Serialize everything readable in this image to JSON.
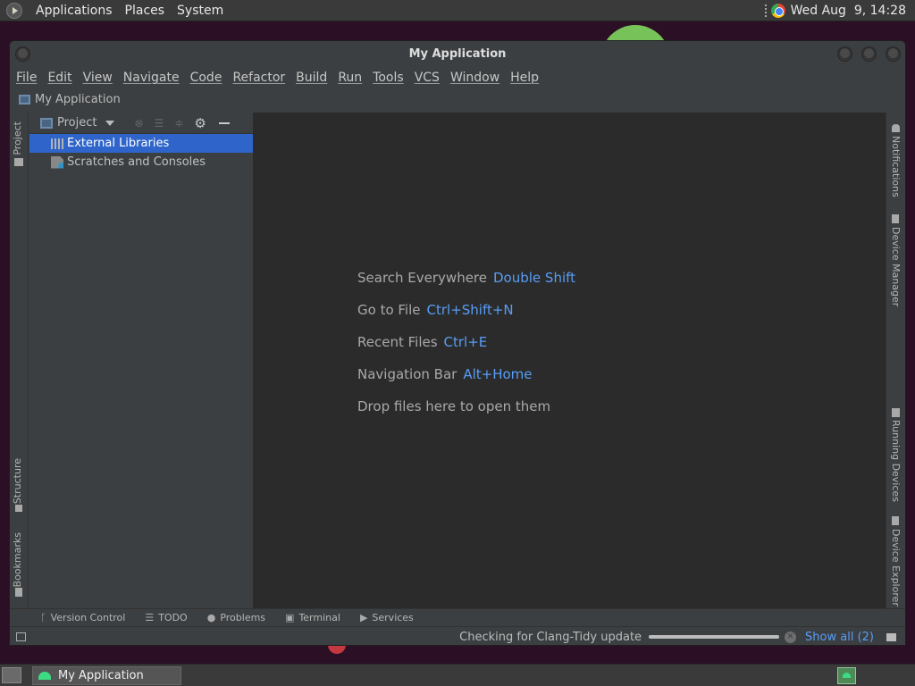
{
  "top_panel": {
    "menus": [
      "Applications",
      "Places",
      "System"
    ],
    "clock": "Wed Aug  9, 14:28"
  },
  "window": {
    "title": "My Application",
    "menubar": [
      "File",
      "Edit",
      "View",
      "Navigate",
      "Code",
      "Refactor",
      "Build",
      "Run",
      "Tools",
      "VCS",
      "Window",
      "Help"
    ],
    "breadcrumb": "My Application"
  },
  "left_strip": {
    "tabs": [
      "Project",
      "Structure",
      "Bookmarks"
    ]
  },
  "project_panel": {
    "title": "Project",
    "tree": [
      {
        "label": "External Libraries",
        "icon": "library-icon",
        "selected": true
      },
      {
        "label": "Scratches and Consoles",
        "icon": "scratches-icon",
        "selected": false
      }
    ]
  },
  "editor": {
    "hints": [
      {
        "label": "Search Everywhere",
        "key": "Double Shift"
      },
      {
        "label": "Go to File",
        "key": "Ctrl+Shift+N"
      },
      {
        "label": "Recent Files",
        "key": "Ctrl+E"
      },
      {
        "label": "Navigation Bar",
        "key": "Alt+Home"
      }
    ],
    "drop_text": "Drop files here to open them"
  },
  "right_strip": {
    "tabs": [
      "Notifications",
      "Device Manager",
      "Running Devices",
      "Device Explorer"
    ]
  },
  "bottom_tabs": [
    "Version Control",
    "TODO",
    "Problems",
    "Terminal",
    "Services"
  ],
  "status_bar": {
    "message": "Checking for Clang-Tidy update",
    "progress": 1.0,
    "show_all": "Show all (2)"
  },
  "taskbar": {
    "task": "My Application"
  },
  "colors": {
    "accent": "#589df6",
    "selection": "#2f65ca",
    "editor_bg": "#2b2b2b",
    "panel_bg": "#3c3f41"
  }
}
